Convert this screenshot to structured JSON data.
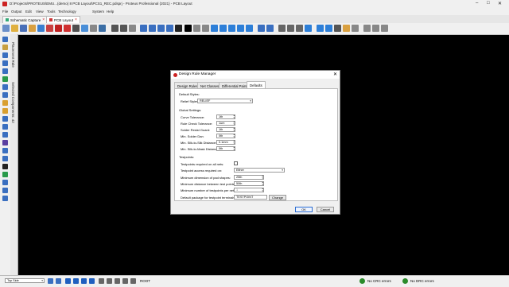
{
  "window": {
    "title": "D:\\Projects\\PROTEUS\\EMU...(demo) 8 PCB Layout\\PCS1_REC.pdsprj - Proteus Professional (2021) - PCB Layout",
    "controls": [
      "–",
      "□",
      "✕"
    ]
  },
  "menu": [
    "File",
    "Output",
    "Edit",
    "View",
    "Tools",
    "Technology",
    "System",
    "Help"
  ],
  "tabs": [
    {
      "label": "Schematic Capture",
      "active": false
    },
    {
      "label": "PCB Layout",
      "active": true
    }
  ],
  "side_labels": [
    "Placement Rule",
    "Selected Components: 42"
  ],
  "dialog": {
    "title": "Design Rule Manager",
    "tabs": [
      "Design Rules",
      "Net Classes",
      "Differential Pairs",
      "Defaults"
    ],
    "default_styles_header": "Default Styles:",
    "relief_label": "Relief Styles:",
    "relief_value": "RELIEF",
    "global_header": "Global Settings:",
    "settings": [
      {
        "label": "Curve Tolerance:",
        "value": "1th"
      },
      {
        "label": "Rule Check Tolerance:",
        "value": "1um"
      },
      {
        "label": "Solder Resist Guard:",
        "value": "1th"
      },
      {
        "label": "Min. Solder Dam:",
        "value": "0th"
      },
      {
        "label": "Min. Silk-to-Silk Distance:",
        "value": "0.1mm"
      },
      {
        "label": "Min. Silk-to-Mask Distance:",
        "value": "0th"
      }
    ],
    "testpoints_header": "Testpoints:",
    "tp_required_label": "Testpoints required on all nets:",
    "tp_access_label": "Testpoint access required on:",
    "tp_access_value": "Either",
    "tp_min_pad_label": "Minimum dimension of pad shapes:",
    "tp_min_pad_value": "25th",
    "tp_min_dist_label": "Minimum distance between test points:",
    "tp_min_dist_value": "50th",
    "tp_min_num_label": "Minimum number of testpoints per net:",
    "tp_min_num_value": "1",
    "tp_package_label": "Default package for testpoint terminals:",
    "tp_package_value": "TESTPOINT",
    "change_label": "Change",
    "ok_label": "OK",
    "cancel_label": "Cancel"
  },
  "status": {
    "layer": "Top Side",
    "mode": "ROOT",
    "drc1": "No CRC errors",
    "drc2": "No DRC errors"
  },
  "colors": {
    "accent": "#c22222",
    "ok_border": "#2a6bd1"
  }
}
